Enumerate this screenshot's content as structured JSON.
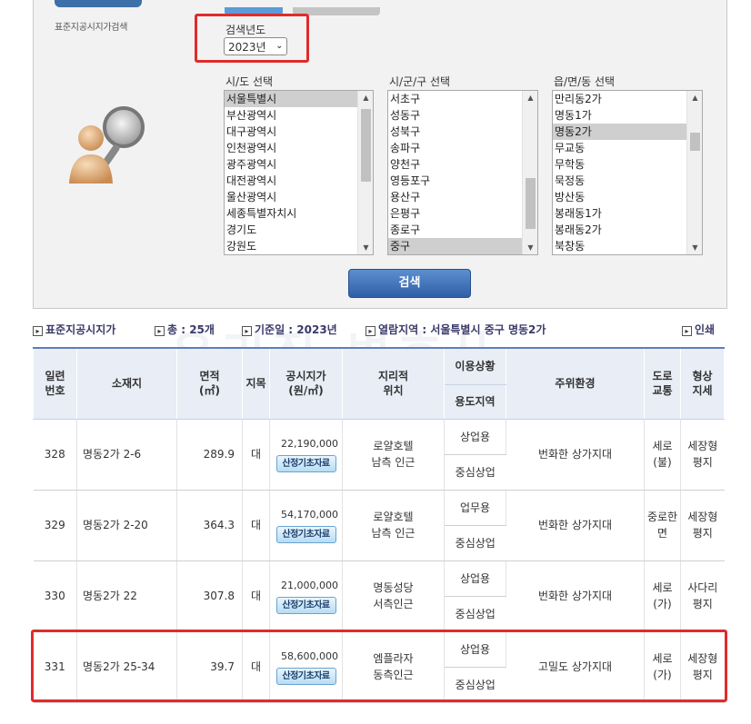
{
  "header": {
    "subtitle": "표준지공시지가검색"
  },
  "search": {
    "year_label": "검색년도",
    "year_value": "2023년",
    "sido": {
      "label": "시/도 선택",
      "items": [
        "서울특별시",
        "부산광역시",
        "대구광역시",
        "인천광역시",
        "광주광역시",
        "대전광역시",
        "울산광역시",
        "세종특별자치시",
        "경기도",
        "강원도"
      ],
      "selected": "서울특별시"
    },
    "sigungu": {
      "label": "시/군/구 선택",
      "items": [
        "서초구",
        "성동구",
        "성북구",
        "송파구",
        "양천구",
        "영등포구",
        "용산구",
        "은평구",
        "종로구",
        "중구"
      ],
      "selected": "중구"
    },
    "dong": {
      "label": "읍/면/동 선택",
      "items": [
        "만리동2가",
        "명동1가",
        "명동2가",
        "무교동",
        "무학동",
        "묵정동",
        "방산동",
        "봉래동1가",
        "봉래동2가",
        "북창동"
      ],
      "selected": "명동2가"
    },
    "search_button": "검색"
  },
  "info": {
    "title": "표준지공시지가",
    "count": "총 : 25개",
    "base_date": "기준일 : 2023년",
    "region": "열람지역 : 서울특별시 중구 명동2가",
    "print": "인쇄"
  },
  "watermark": "우리집 변호사",
  "table": {
    "headers": {
      "no": "일련\n번호",
      "address": "소재지",
      "area": "면적\n(㎡)",
      "jimok": "지목",
      "price": "공시지가\n(원/㎡)",
      "location": "지리적\n위치",
      "usage": "이용상황",
      "zone": "용도지역",
      "surroundings": "주위환경",
      "road": "도로\n교통",
      "shape": "형상\n지세"
    },
    "calc_button": "산정기초자료",
    "rows": [
      {
        "no": "328",
        "address": "명동2가 2-6",
        "area": "289.9",
        "jimok": "대",
        "price": "22,190,000",
        "location": "로얄호텔\n남측 인근",
        "usage": "상업용",
        "zone": "중심상업",
        "surroundings": "번화한 상가지대",
        "road": "세로\n(불)",
        "shape": "세장형\n평지"
      },
      {
        "no": "329",
        "address": "명동2가 2-20",
        "area": "364.3",
        "jimok": "대",
        "price": "54,170,000",
        "location": "로얄호텔\n남측 인근",
        "usage": "업무용",
        "zone": "중심상업",
        "surroundings": "번화한 상가지대",
        "road": "중로한\n면",
        "shape": "세장형\n평지"
      },
      {
        "no": "330",
        "address": "명동2가 22",
        "area": "307.8",
        "jimok": "대",
        "price": "21,000,000",
        "location": "명동성당\n서측인근",
        "usage": "상업용",
        "zone": "중심상업",
        "surroundings": "번화한 상가지대",
        "road": "세로\n(가)",
        "shape": "사다리\n평지"
      },
      {
        "no": "331",
        "address": "명동2가 25-34",
        "area": "39.7",
        "jimok": "대",
        "price": "58,600,000",
        "location": "엠플라자\n동측인근",
        "usage": "상업용",
        "zone": "중심상업",
        "surroundings": "고밀도 상가지대",
        "road": "세로\n(가)",
        "shape": "세장형\n평지"
      }
    ]
  }
}
